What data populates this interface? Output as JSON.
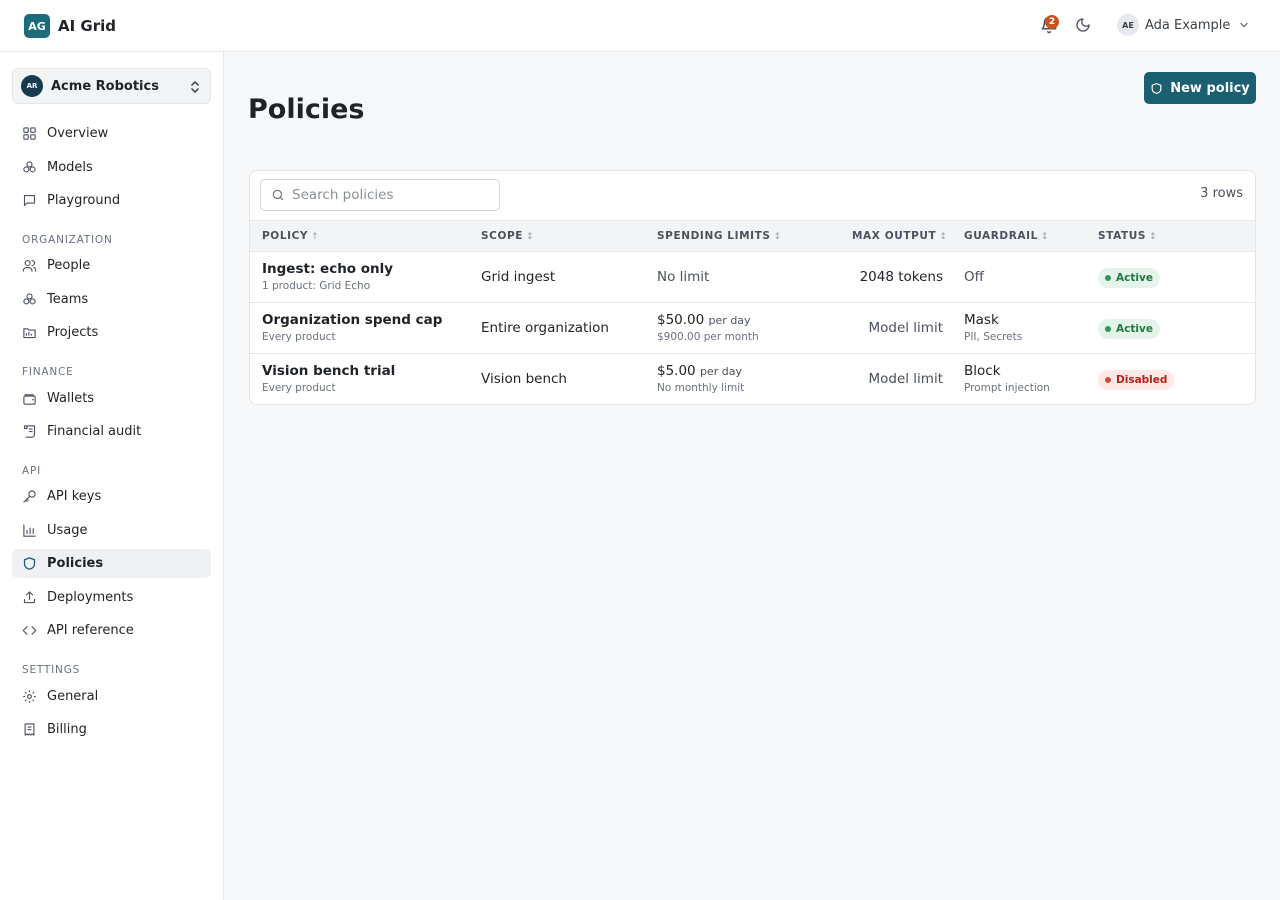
{
  "app": {
    "logo_text": "AG",
    "name": "AI Grid"
  },
  "header": {
    "notifications_count": "2",
    "user": {
      "initials": "AE",
      "name": "Ada Example"
    }
  },
  "org": {
    "initials": "AR",
    "name": "Acme Robotics"
  },
  "sidebar": {
    "items": [
      {
        "label": "Overview",
        "icon": "grid-icon"
      },
      {
        "label": "Models",
        "icon": "models-icon"
      },
      {
        "label": "Playground",
        "icon": "chat-icon"
      }
    ],
    "sections": [
      {
        "title": "ORGANIZATION",
        "items": [
          {
            "label": "People",
            "icon": "people-icon"
          },
          {
            "label": "Teams",
            "icon": "teams-icon"
          },
          {
            "label": "Projects",
            "icon": "folder-icon"
          }
        ]
      },
      {
        "title": "FINANCE",
        "items": [
          {
            "label": "Wallets",
            "icon": "wallet-icon"
          },
          {
            "label": "Financial audit",
            "icon": "scroll-icon"
          }
        ]
      },
      {
        "title": "API",
        "items": [
          {
            "label": "API keys",
            "icon": "key-icon"
          },
          {
            "label": "Usage",
            "icon": "bar-chart-icon"
          },
          {
            "label": "Policies",
            "icon": "shield-icon",
            "active": true
          },
          {
            "label": "Deployments",
            "icon": "upload-icon"
          },
          {
            "label": "API reference",
            "icon": "code-icon"
          }
        ]
      },
      {
        "title": "SETTINGS",
        "items": [
          {
            "label": "General",
            "icon": "gear-icon"
          },
          {
            "label": "Billing",
            "icon": "receipt-icon"
          }
        ]
      }
    ]
  },
  "page": {
    "title": "Policies",
    "new_button": "New policy"
  },
  "table": {
    "search_placeholder": "Search policies",
    "row_count": "3 rows",
    "columns": [
      "POLICY",
      "SCOPE",
      "SPENDING LIMITS",
      "MAX OUTPUT",
      "GUARDRAIL",
      "STATUS"
    ],
    "sort_marks": [
      "↑",
      "↕",
      "↕",
      "↕",
      "↕",
      "↕"
    ],
    "rows": [
      {
        "policy": "Ingest: echo only",
        "policy_sub": "1 product: Grid Echo",
        "scope": "Grid ingest",
        "spend_main": "No limit",
        "spend_unit": "",
        "spend_sub": "",
        "max_output": "2048 tokens",
        "guardrail": "Off",
        "guardrail_sub": "",
        "status": "Active"
      },
      {
        "policy": "Organization spend cap",
        "policy_sub": "Every product",
        "scope": "Entire organization",
        "spend_main": "$50.00",
        "spend_unit": "per day",
        "spend_sub": "$900.00 per month",
        "max_output": "Model limit",
        "guardrail": "Mask",
        "guardrail_sub": "PII, Secrets",
        "status": "Active"
      },
      {
        "policy": "Vision bench trial",
        "policy_sub": "Every product",
        "scope": "Vision bench",
        "spend_main": "$5.00",
        "spend_unit": "per day",
        "spend_sub": "No monthly limit",
        "max_output": "Model limit",
        "guardrail": "Block",
        "guardrail_sub": "Prompt injection",
        "status": "Disabled"
      }
    ]
  },
  "colors": {
    "brand": "#1b5f70",
    "active_badge": "#1f7a3e",
    "disabled_badge": "#b42318",
    "notification": "#c8531f"
  }
}
